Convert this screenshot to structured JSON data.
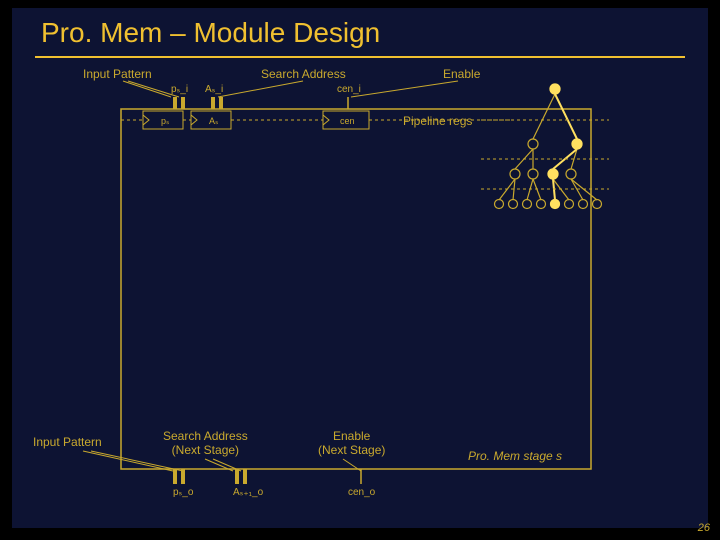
{
  "title": "Pro. Mem – Module Design",
  "top_labels": {
    "input_pattern": "Input Pattern",
    "search_address": "Search Address",
    "enable": "Enable"
  },
  "top_signals": {
    "ps_i": "pₛ_i",
    "as_i": "Aₛ_i",
    "cen_i": "cen_i"
  },
  "reg_labels": {
    "ps": "pₛ",
    "as": "Aₛ",
    "cen": "cen"
  },
  "pipeline_regs": "Pipeline regs",
  "bottom_labels": {
    "input_pattern": "Input Pattern",
    "search_address_next": "Search Address\n(Next Stage)",
    "enable_next": "Enable\n(Next Stage)"
  },
  "bottom_signals": {
    "ps_o": "pₛ_o",
    "as1_o": "Aₛ₊₁_o",
    "cen_o": "cen_o"
  },
  "stage_caption": "Pro. Mem stage s",
  "page": "26"
}
